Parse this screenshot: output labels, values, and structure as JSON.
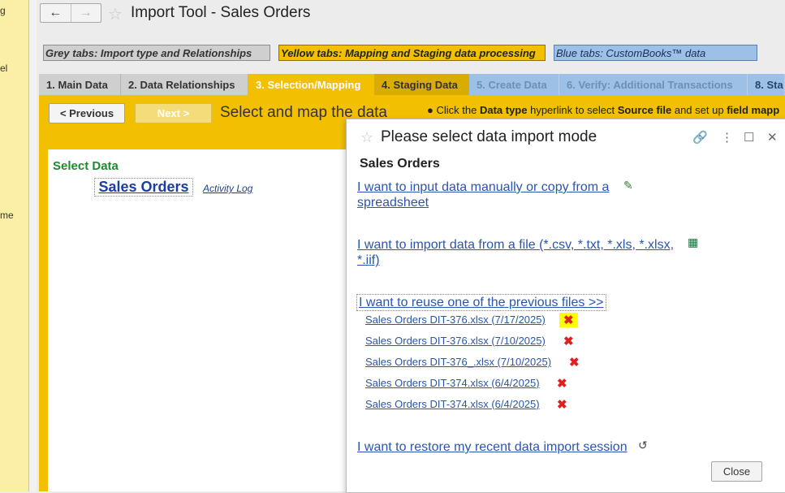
{
  "left_panel": {
    "fragments": [
      "g",
      "el",
      "me"
    ]
  },
  "window": {
    "title": "Import Tool - Sales Orders",
    "back_glyph": "←",
    "forward_glyph": "→",
    "star_glyph": "☆"
  },
  "legend": {
    "grey": "Grey tabs: Import type and Relationships",
    "yellow": "Yellow tabs: Mapping and Staging data processing",
    "blue": "Blue tabs: CustomBooks™ data"
  },
  "tabs": [
    {
      "label": "1. Main Data",
      "style": "grey"
    },
    {
      "label": "2. Data Relationships",
      "style": "grey"
    },
    {
      "label": "3. Selection/Mapping",
      "style": "active"
    },
    {
      "label": "4. Staging Data",
      "style": "yellow"
    },
    {
      "label": "5. Create Data",
      "style": "blue"
    },
    {
      "label": "6. Verify: Additional Transactions",
      "style": "blue"
    },
    {
      "label": "8. Sta",
      "style": "blue last"
    }
  ],
  "toolbar": {
    "previous_label": "< Previous",
    "next_label": "Next >",
    "subtitle": "Select and map the data",
    "hint_bullet": "●",
    "hint_1": "Click the ",
    "hint_2": "Data type",
    "hint_3": " hyperlink to select ",
    "hint_4": "Source file",
    "hint_5": " and set up ",
    "hint_6": "field mapp"
  },
  "main": {
    "select_data_label": "Select Data",
    "sales_orders_label": "Sales Orders",
    "activity_log_label": "Activity Log"
  },
  "dialog": {
    "star_glyph": "☆",
    "title": "Please select data import mode",
    "link_icon": "🔗",
    "menu_icon": "⋮",
    "maximize_icon": "☐",
    "close_icon": "✕",
    "heading": "Sales Orders",
    "option_manual_line1": "I want to input data manually or copy from a",
    "option_manual_line2": "spreadsheet",
    "option_file_line1": "I want to import data from a file (*.csv, *.txt, *.xls, *.xlsx,",
    "option_file_line2": "*.iif)",
    "option_reuse": "I want to reuse one of the previous files  >>",
    "recent_files": [
      "Sales Orders DIT-376.xlsx (7/17/2025)",
      "Sales Orders DIT-376.xlsx (7/10/2025)",
      "Sales Orders DIT-376_.xlsx (7/10/2025)",
      "Sales Orders DIT-374.xlsx (6/4/2025)",
      "Sales Orders DIT-374.xlsx (6/4/2025)"
    ],
    "delete_glyph": "✖",
    "option_restore": "I want to restore my recent data import session",
    "pencil_icon": "✎",
    "excel_icon": "▦",
    "history_icon": "↺",
    "close_button": "Close"
  },
  "colors": {
    "tab_yellow": "#f2c000",
    "tab_blue": "#9cc0e6",
    "link_blue": "#2a55b0",
    "delete_red": "#e02020",
    "select_green": "#1f8a2b"
  }
}
